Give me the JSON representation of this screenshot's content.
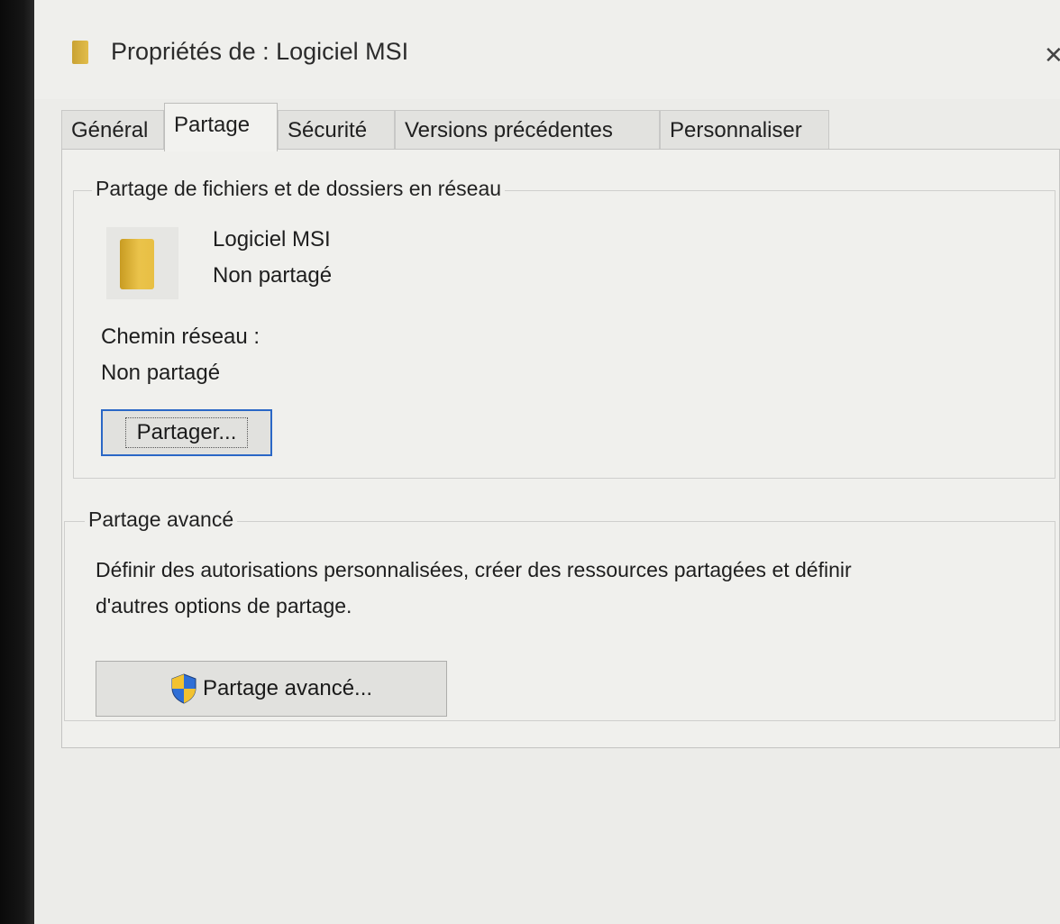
{
  "window": {
    "title": "Propriétés de : Logiciel MSI",
    "close_glyph": "✕"
  },
  "tabs": [
    {
      "label": "Général"
    },
    {
      "label": "Partage"
    },
    {
      "label": "Sécurité"
    },
    {
      "label": "Versions précédentes"
    },
    {
      "label": "Personnaliser"
    }
  ],
  "active_tab": "Partage",
  "network_sharing": {
    "legend": "Partage de fichiers et de dossiers en réseau",
    "folder_name": "Logiciel MSI",
    "folder_status": "Non partagé",
    "path_label": "Chemin réseau :",
    "path_value": "Non partagé",
    "share_button": "Partager..."
  },
  "advanced_sharing": {
    "legend": "Partage avancé",
    "description_line1": "Définir des autorisations personnalisées, créer des ressources partagées et définir",
    "description_line2": "d'autres options de partage.",
    "button": "Partage avancé..."
  },
  "icons": {
    "title": "folder-icon",
    "folder": "folder-icon",
    "shield": "shield-icon",
    "close": "close-icon"
  },
  "colors": {
    "folder": "#e2bd4b",
    "focus_border": "#2a67c6",
    "shield_blue": "#2f6fd6",
    "shield_yellow": "#f2c230"
  }
}
